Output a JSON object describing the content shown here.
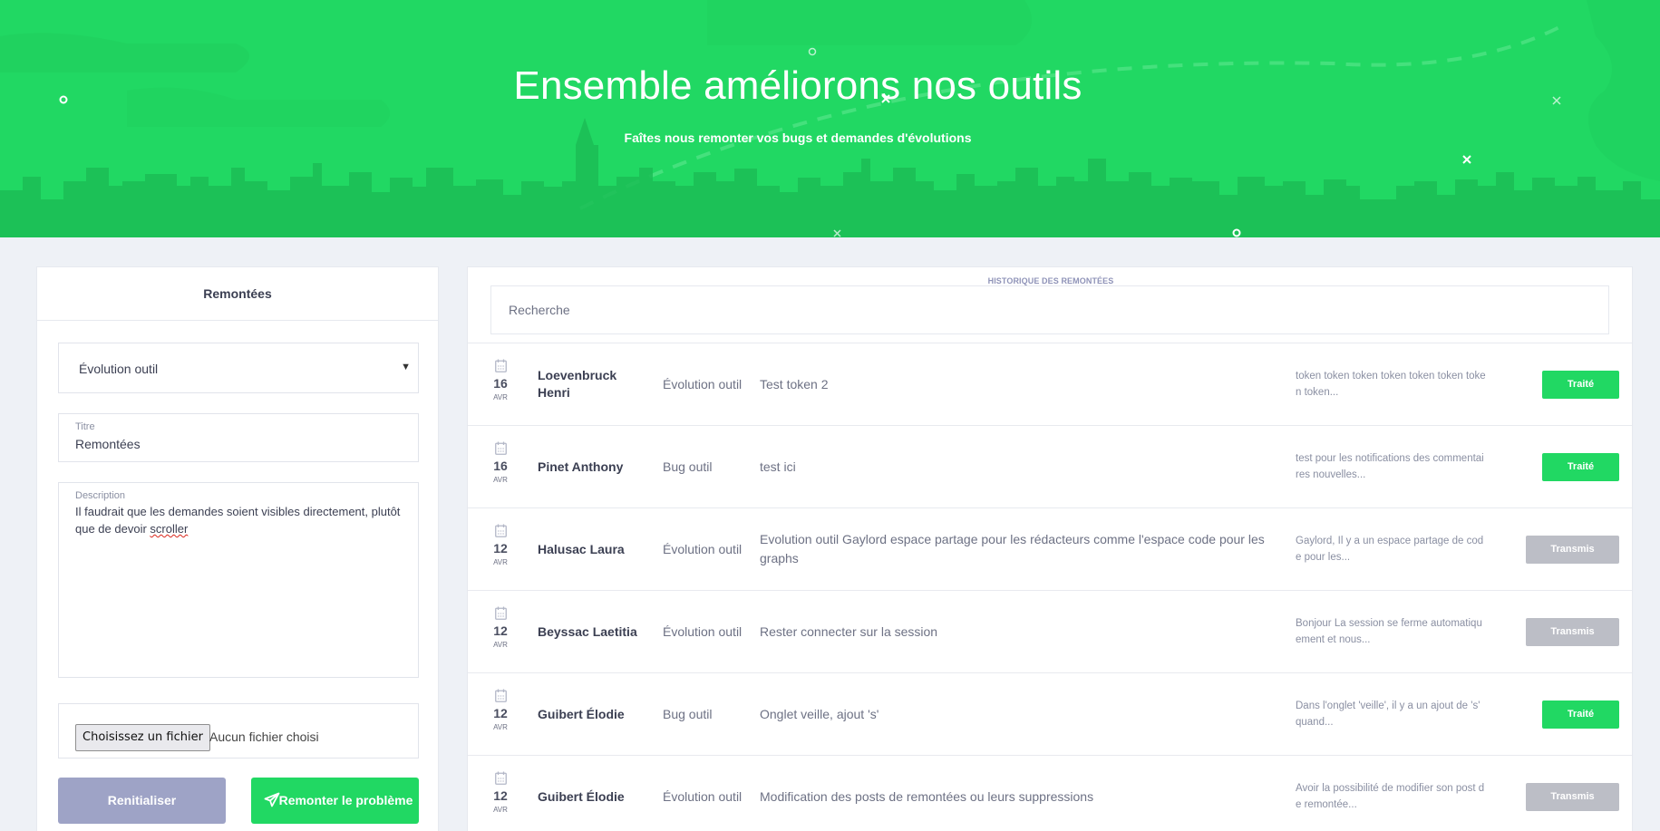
{
  "hero": {
    "title": "Ensemble améliorons nos outils",
    "subtitle": "Faîtes nous remonter vos bugs et demandes d'évolutions"
  },
  "form": {
    "panel_title": "Remontées",
    "category_selected": "Évolution outil",
    "title_label": "Titre",
    "title_value": "Remontées",
    "description_label": "Description",
    "description_text_before": "Il faudrait que les demandes soient visibles directement, plutôt que de devoir ",
    "description_text_misspelled": "scroller",
    "file_button": "Choisissez un fichier",
    "file_status": "Aucun fichier choisi",
    "reset_label": "Renitialiser",
    "submit_label": "Remonter le problème"
  },
  "history": {
    "section_label": "HISTORIQUE DES REMONTÉES",
    "search_placeholder": "Recherche",
    "rows": [
      {
        "day": "16",
        "month": "AVR",
        "name": "Loevenbruck Henri",
        "category": "Évolution outil",
        "title": "Test token 2",
        "excerpt": "token token token token token token token token...",
        "status": "Traité",
        "status_type": "done"
      },
      {
        "day": "16",
        "month": "AVR",
        "name": "Pinet Anthony",
        "category": "Bug outil",
        "title": "test ici",
        "excerpt": "test pour les notifications des commentaires nouvelles...",
        "status": "Traité",
        "status_type": "done"
      },
      {
        "day": "12",
        "month": "AVR",
        "name": "Halusac Laura",
        "category": "Évolution outil",
        "title": "Evolution outil Gaylord espace partage pour les rédacteurs comme l'espace code pour les graphs",
        "excerpt": "Gaylord, Il y a un espace partage de code pour les...",
        "status": "Transmis",
        "status_type": "sent"
      },
      {
        "day": "12",
        "month": "AVR",
        "name": "Beyssac Laetitia",
        "category": "Évolution outil",
        "title": "Rester connecter sur la session",
        "excerpt": "Bonjour La session se ferme automatiquement et nous...",
        "status": "Transmis",
        "status_type": "sent"
      },
      {
        "day": "12",
        "month": "AVR",
        "name": "Guibert Élodie",
        "category": "Bug outil",
        "title": "Onglet veille, ajout 's'",
        "excerpt": "Dans l'onglet 'veille', il y a un ajout de 's' quand...",
        "status": "Traité",
        "status_type": "done"
      },
      {
        "day": "12",
        "month": "AVR",
        "name": "Guibert Élodie",
        "category": "Évolution outil",
        "title": "Modification des posts de remontées ou leurs suppressions",
        "excerpt": "Avoir la possibilité de modifier son post de remontée...",
        "status": "Transmis",
        "status_type": "sent"
      }
    ]
  },
  "colors": {
    "brand_green": "#21d863",
    "reset_purple": "#9ea3c6",
    "status_sent_gray": "#bcbec6"
  }
}
